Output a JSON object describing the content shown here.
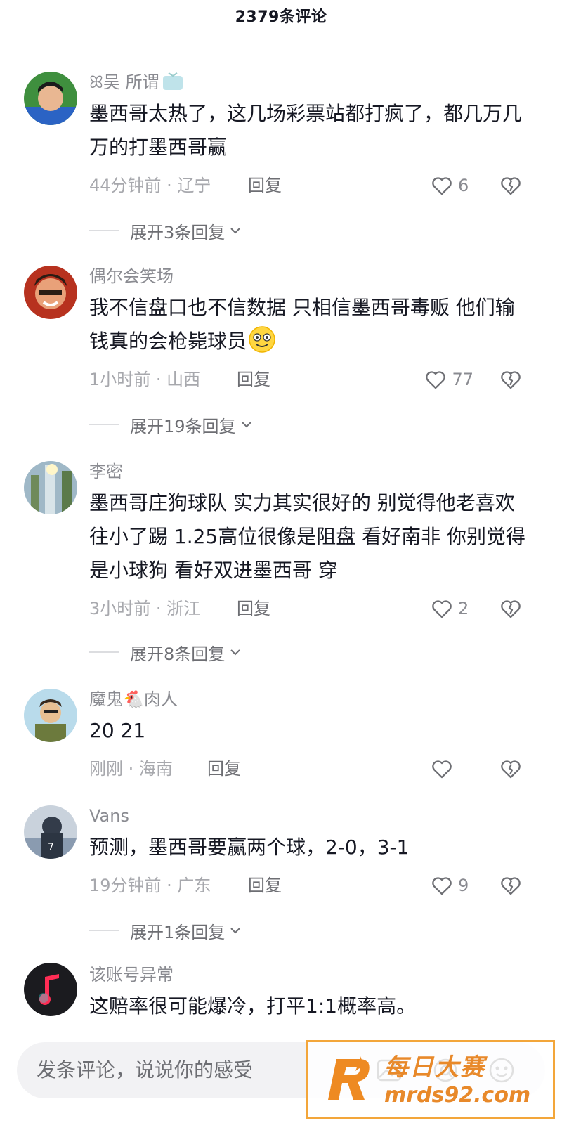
{
  "header": {
    "title": "2379条评论"
  },
  "comments": [
    {
      "username": "ꕤ吴 所谓",
      "text": "墨西哥太热了，这几场彩票站都打疯了，都几万几万的打墨西哥赢",
      "time": "44分钟前 · 辽宁",
      "reply_label": "回复",
      "likes": "6",
      "expand": "展开3条回复"
    },
    {
      "username": "偶尔会笑场",
      "text": "我不信盘口也不信数据 只相信墨西哥毒贩 他们输钱真的会枪毙球员",
      "time": "1小时前 · 山西",
      "reply_label": "回复",
      "likes": "77",
      "expand": "展开19条回复"
    },
    {
      "username": "李密",
      "text": "墨西哥庄狗球队 实力其实很好的 别觉得他老喜欢往小了踢 1.25高位很像是阻盘 看好南非 你别觉得是小球狗 看好双进墨西哥 穿",
      "time": "3小时前 · 浙江",
      "reply_label": "回复",
      "likes": "2",
      "expand": "展开8条回复"
    },
    {
      "username": "魔鬼🐔肉人",
      "text": "20 21",
      "time": "刚刚 · 海南",
      "reply_label": "回复",
      "likes": ""
    },
    {
      "username": "Vans",
      "text": "预测，墨西哥要赢两个球，2-0，3-1",
      "time": "19分钟前 · 广东",
      "reply_label": "回复",
      "likes": "9",
      "expand": "展开1条回复"
    },
    {
      "username": "该账号异常",
      "text": "这赔率很可能爆冷，打平1:1概率高。"
    }
  ],
  "input": {
    "placeholder": "发条评论，说说你的感受"
  },
  "watermark": {
    "title": "每日大赛",
    "url": "mrds92.com"
  },
  "colors": {
    "text": "#161823",
    "muted": "#8a8b91",
    "accent": "#e8892a"
  },
  "icons": [
    "heart-icon",
    "dislike-icon",
    "chevron-down-icon",
    "image-icon",
    "at-icon",
    "emoji-icon",
    "tv-icon",
    "smile-emoji-icon"
  ]
}
